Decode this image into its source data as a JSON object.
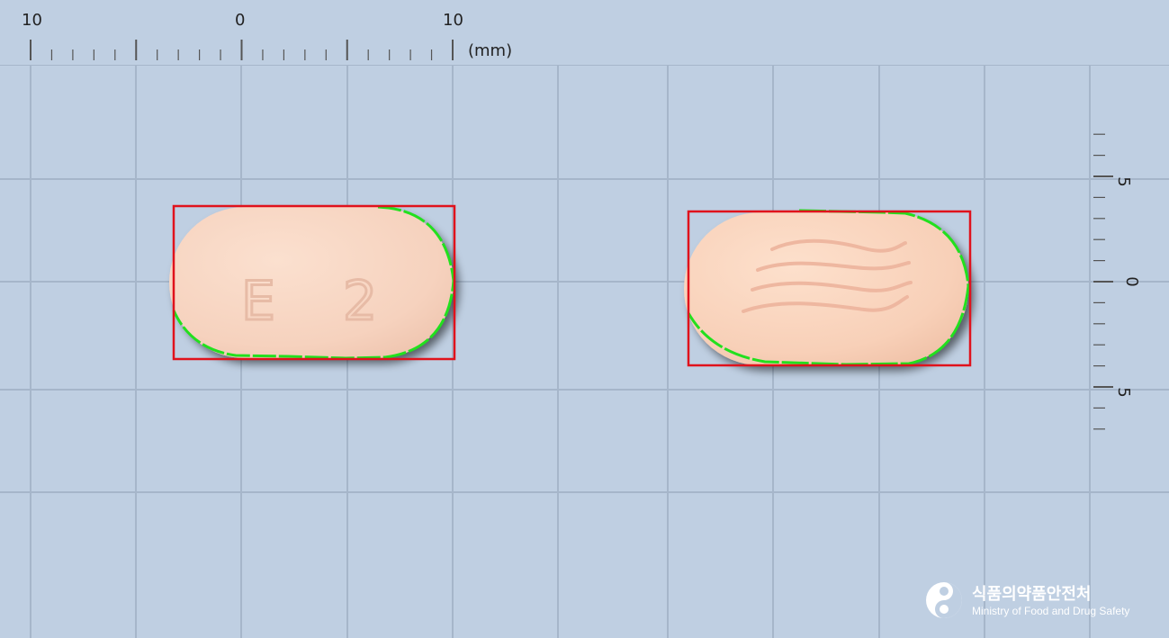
{
  "ruler_top": {
    "labels": [
      "10",
      "0",
      "10"
    ],
    "unit": "(mm)"
  },
  "ruler_right": {
    "labels": [
      "5",
      "0",
      "5"
    ]
  },
  "pill_front": {
    "imprint": "E 2"
  },
  "logo": {
    "korean": "식품의약품안전처",
    "english": "Ministry of Food and Drug Safety"
  },
  "colors": {
    "background": "#bfcfe2",
    "grid": "#a6b6ca",
    "pill": "#f8d6c3",
    "bbox": "#e0121c",
    "contour": "#22e01e"
  }
}
